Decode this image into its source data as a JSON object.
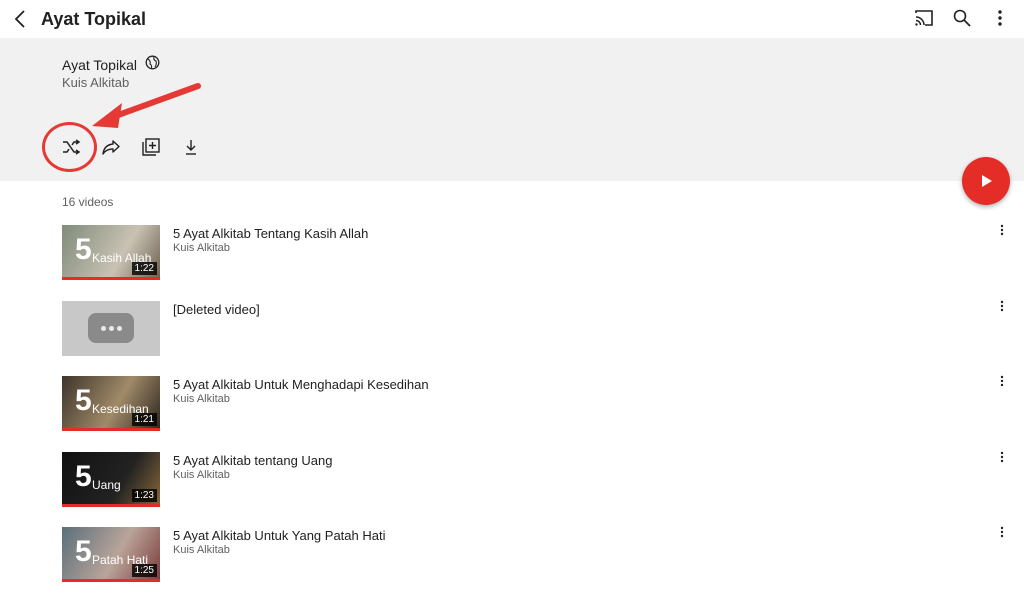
{
  "topbar": {
    "title": "Ayat Topikal",
    "icons": [
      "back-arrow-icon",
      "cast-icon",
      "search-icon",
      "more-vert-icon"
    ]
  },
  "playlist": {
    "title": "Ayat Topikal",
    "channel": "Kuis Alkitab",
    "visibility_icon": "public-globe-icon",
    "actions": [
      "shuffle-icon",
      "share-icon",
      "add-to-library-icon",
      "download-icon"
    ],
    "video_count": "16 videos"
  },
  "colors": {
    "accent": "#e52d27",
    "annotation": "#e53935",
    "header_bg": "#f1f1f1"
  },
  "videos": [
    {
      "title": "5 Ayat Alkitab Tentang Kasih Allah",
      "channel": "Kuis Alkitab",
      "duration": "1:22",
      "thumb_word": "Kasih Allah"
    },
    {
      "title": "[Deleted video]",
      "channel": "",
      "duration": "",
      "thumb_word": ""
    },
    {
      "title": "5 Ayat Alkitab Untuk Menghadapi Kesedihan",
      "channel": "Kuis Alkitab",
      "duration": "1:21",
      "thumb_word": "Kesedihan"
    },
    {
      "title": "5 Ayat Alkitab tentang Uang",
      "channel": "Kuis Alkitab",
      "duration": "1:23",
      "thumb_word": "Uang"
    },
    {
      "title": "5 Ayat Alkitab Untuk Yang Patah Hati",
      "channel": "Kuis Alkitab",
      "duration": "1:25",
      "thumb_word": "Patah Hati"
    }
  ]
}
